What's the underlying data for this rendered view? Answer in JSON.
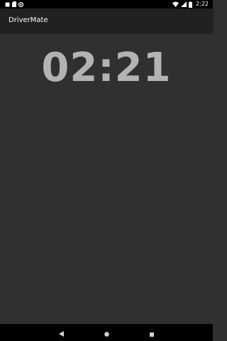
{
  "status_bar": {
    "time": "2:22",
    "left_icons": [
      "notification-square-icon",
      "sd-card-icon",
      "sync-icon"
    ],
    "right_icons": [
      "wifi-icon",
      "signal-icon",
      "battery-icon"
    ]
  },
  "app_bar": {
    "title": "DriverMate",
    "background": "#212121"
  },
  "main": {
    "timer": "02:21",
    "timer_color": "#b3b3b3",
    "background": "#303030"
  },
  "nav_bar": {
    "buttons": [
      "back-icon",
      "home-icon",
      "recents-icon"
    ]
  }
}
